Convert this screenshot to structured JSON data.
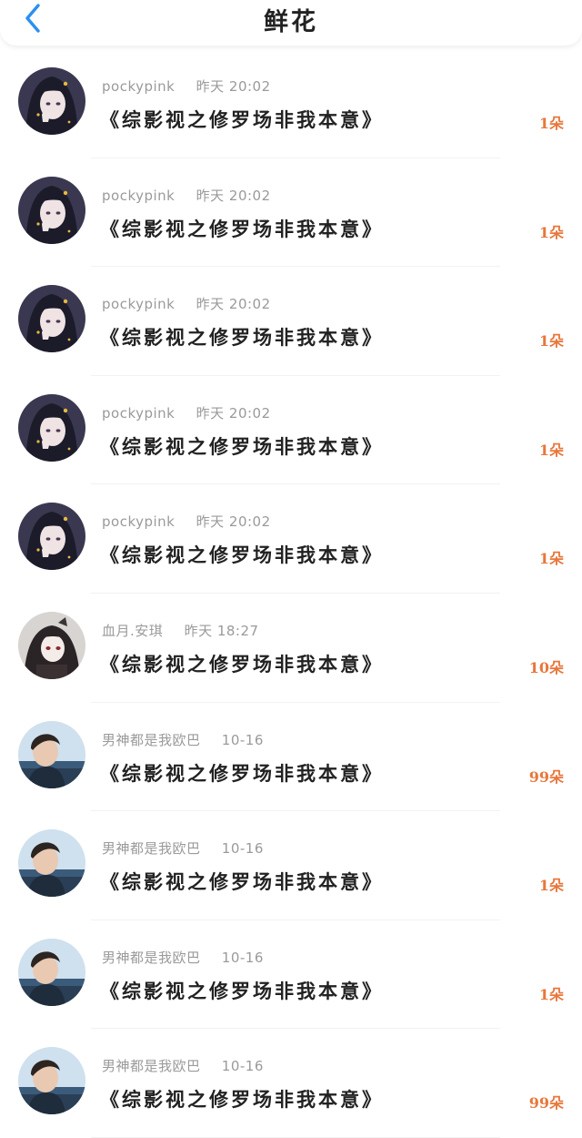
{
  "header": {
    "title": "鲜花",
    "back_icon": "chevron-left-icon",
    "accent": "#2b8ff0"
  },
  "colors": {
    "count": "#e8773c",
    "meta": "#9a9a9a",
    "book": "#222222"
  },
  "rows": [
    {
      "user": "pockypink",
      "time": "昨天 20:02",
      "book": "《综影视之修罗场非我本意》",
      "count": "1朵",
      "avatar": "anime-girl-avatar"
    },
    {
      "user": "pockypink",
      "time": "昨天 20:02",
      "book": "《综影视之修罗场非我本意》",
      "count": "1朵",
      "avatar": "anime-girl-avatar"
    },
    {
      "user": "pockypink",
      "time": "昨天 20:02",
      "book": "《综影视之修罗场非我本意》",
      "count": "1朵",
      "avatar": "anime-girl-avatar"
    },
    {
      "user": "pockypink",
      "time": "昨天 20:02",
      "book": "《综影视之修罗场非我本意》",
      "count": "1朵",
      "avatar": "anime-girl-avatar"
    },
    {
      "user": "pockypink",
      "time": "昨天 20:02",
      "book": "《综影视之修罗场非我本意》",
      "count": "1朵",
      "avatar": "anime-girl-avatar"
    },
    {
      "user": "血月.安琪",
      "time": "昨天 18:27",
      "book": "《综影视之修罗场非我本意》",
      "count": "10朵",
      "avatar": "gothic-girl-avatar"
    },
    {
      "user": "男神都是我欧巴",
      "time": "10-16",
      "book": "《综影视之修罗场非我本意》",
      "count": "99朵",
      "avatar": "man-photo-avatar"
    },
    {
      "user": "男神都是我欧巴",
      "time": "10-16",
      "book": "《综影视之修罗场非我本意》",
      "count": "1朵",
      "avatar": "man-photo-avatar"
    },
    {
      "user": "男神都是我欧巴",
      "time": "10-16",
      "book": "《综影视之修罗场非我本意》",
      "count": "1朵",
      "avatar": "man-photo-avatar"
    },
    {
      "user": "男神都是我欧巴",
      "time": "10-16",
      "book": "《综影视之修罗场非我本意》",
      "count": "99朵",
      "avatar": "man-photo-avatar"
    }
  ]
}
